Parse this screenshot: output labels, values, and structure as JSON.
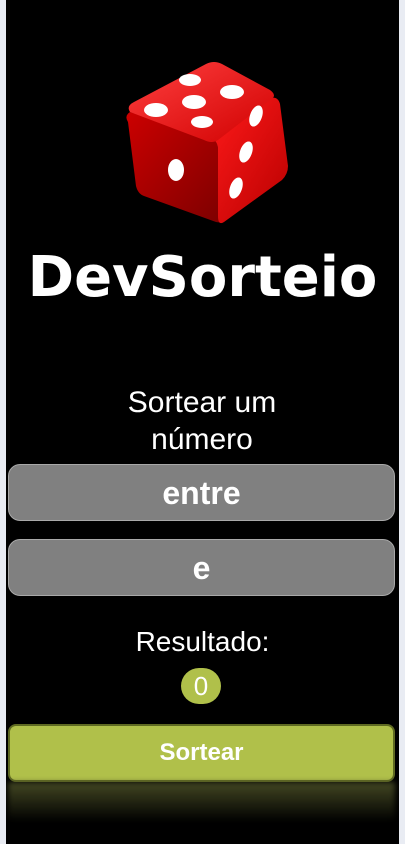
{
  "app": {
    "title": "DevSorteio",
    "logo_icon": "red-dice-icon"
  },
  "form": {
    "intro_text": "Sortear um número",
    "min_placeholder": "entre",
    "max_placeholder": "e"
  },
  "result": {
    "label": "Resultado:",
    "value": "0"
  },
  "actions": {
    "draw_label": "Sortear"
  },
  "colors": {
    "background": "#000000",
    "field_background": "#808080",
    "accent": "#b0c04a",
    "dice_red": "#e00000"
  }
}
